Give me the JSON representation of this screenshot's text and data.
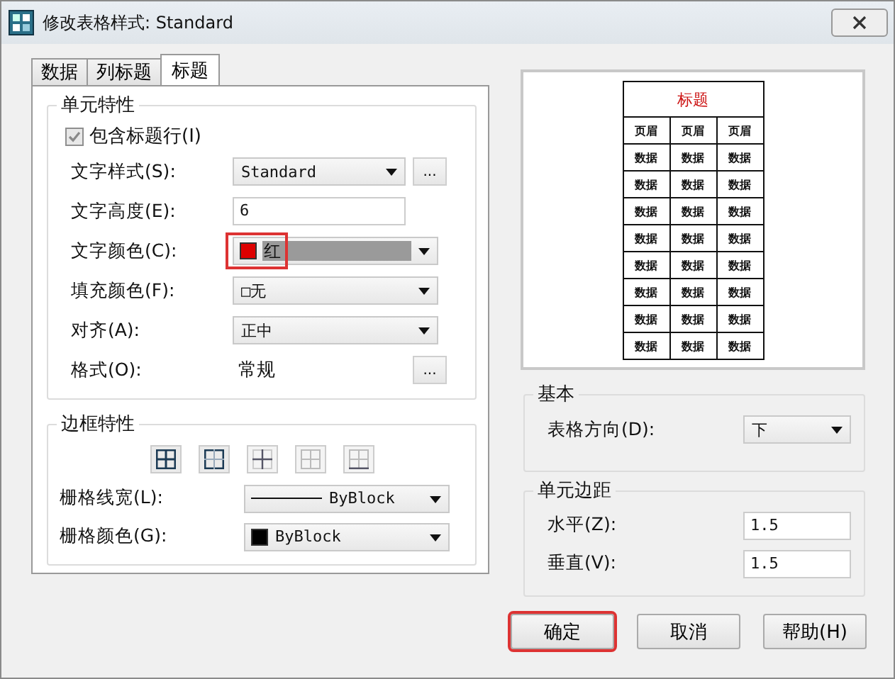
{
  "window": {
    "title": "修改表格样式: Standard"
  },
  "tabs": [
    {
      "label": "数据",
      "selected": false
    },
    {
      "label": "列标题",
      "selected": false
    },
    {
      "label": "标题",
      "selected": true
    }
  ],
  "cell_properties": {
    "title": "单元特性",
    "include_header": {
      "label": "包含标题行(I)",
      "checked": true,
      "disabled": true
    },
    "fields": [
      {
        "kind": "dropdown",
        "label": "文字样式(S):",
        "value": "Standard",
        "more_button": "..."
      },
      {
        "kind": "input",
        "label": "文字高度(E):",
        "value": "6"
      },
      {
        "kind": "dropdown",
        "label": "文字颜色(C):",
        "value": "红",
        "swatch": {
          "kind": "color",
          "color": "#dd0000"
        },
        "value_selected": true,
        "highlighted": true,
        "wide": true
      },
      {
        "kind": "dropdown",
        "label": "填充颜色(F):",
        "value": "□无",
        "wide": true
      },
      {
        "kind": "dropdown",
        "label": "对齐(A):",
        "value": "正中",
        "wide": true
      },
      {
        "kind": "text",
        "label": "格式(O):",
        "value": "常规",
        "more_button": "..."
      }
    ]
  },
  "border_properties": {
    "title": "边框特性",
    "border_buttons": [
      {
        "kind": "all"
      },
      {
        "kind": "outside"
      },
      {
        "kind": "inside"
      },
      {
        "kind": "none"
      },
      {
        "kind": "bottom"
      }
    ],
    "fields": [
      {
        "kind": "dropdown",
        "label": "栅格线宽(L):",
        "value": "ByBlock",
        "swatch": {
          "kind": "line"
        },
        "wide": true
      },
      {
        "kind": "dropdown",
        "label": "栅格颜色(G):",
        "value": "ByBlock",
        "swatch": {
          "kind": "color",
          "color": "#000000"
        },
        "wide": true
      }
    ]
  },
  "preview": {
    "title": "标题",
    "header": [
      "页眉",
      "页眉",
      "页眉"
    ],
    "rows": [
      [
        "数据",
        "数据",
        "数据"
      ],
      [
        "数据",
        "数据",
        "数据"
      ],
      [
        "数据",
        "数据",
        "数据"
      ],
      [
        "数据",
        "数据",
        "数据"
      ],
      [
        "数据",
        "数据",
        "数据"
      ],
      [
        "数据",
        "数据",
        "数据"
      ],
      [
        "数据",
        "数据",
        "数据"
      ],
      [
        "数据",
        "数据",
        "数据"
      ]
    ]
  },
  "basic": {
    "title": "基本",
    "fields": [
      {
        "kind": "dropdown",
        "label": "表格方向(D):",
        "value": "下"
      }
    ]
  },
  "cell_margins": {
    "title": "单元边距",
    "fields": [
      {
        "kind": "input",
        "label": "水平(Z):",
        "value": "1.5"
      },
      {
        "kind": "input",
        "label": "垂直(V):",
        "value": "1.5"
      }
    ]
  },
  "buttons": [
    {
      "label": "确定",
      "highlighted": true
    },
    {
      "label": "取消",
      "highlighted": false
    },
    {
      "label": "帮助(H)",
      "highlighted": false
    }
  ]
}
